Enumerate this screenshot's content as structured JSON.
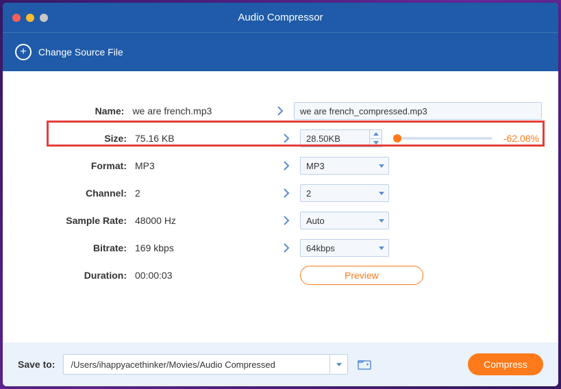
{
  "window": {
    "title": "Audio Compressor"
  },
  "toolbar": {
    "change_source": "Change Source File"
  },
  "labels": {
    "name": "Name:",
    "size": "Size:",
    "format": "Format:",
    "channel": "Channel:",
    "sample_rate": "Sample Rate:",
    "bitrate": "Bitrate:",
    "duration": "Duration:"
  },
  "original": {
    "name": "we are french.mp3",
    "size": "75.16 KB",
    "format": "MP3",
    "channel": "2",
    "sample_rate": "48000 Hz",
    "bitrate": "169 kbps",
    "duration": "00:00:03"
  },
  "target": {
    "name": "we are french_compressed.mp3",
    "size": "28.50KB",
    "size_pct": "-62.08%",
    "format": "MP3",
    "channel": "2",
    "sample_rate": "Auto",
    "bitrate": "64kbps"
  },
  "buttons": {
    "preview": "Preview",
    "compress": "Compress"
  },
  "footer": {
    "save_to": "Save to:",
    "path": "/Users/ihappyacethinker/Movies/Audio Compressed"
  }
}
